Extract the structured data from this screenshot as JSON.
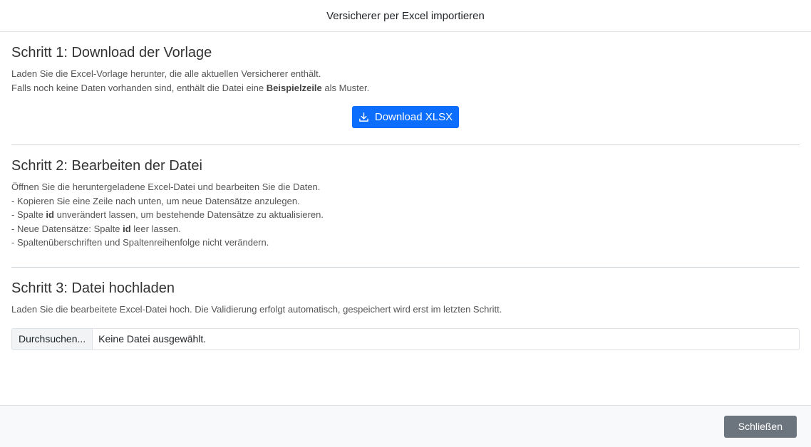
{
  "dialog": {
    "title": "Versicherer per Excel importieren"
  },
  "step1": {
    "heading": "Schritt 1: Download der Vorlage",
    "line1": "Laden Sie die Excel-Vorlage herunter, die alle aktuellen Versicherer enthält.",
    "line2_before": "Falls noch keine Daten vorhanden sind, enthält die Datei eine ",
    "line2_bold": "Beispielzeile",
    "line2_after": " als Muster.",
    "download_label": "Download XLSX",
    "download_icon": "download-icon"
  },
  "step2": {
    "heading": "Schritt 2: Bearbeiten der Datei",
    "line1": "Öffnen Sie die heruntergeladene Excel-Datei und bearbeiten Sie die Daten.",
    "line2": "- Kopieren Sie eine Zeile nach unten, um neue Datensätze anzulegen.",
    "line3_before": "- Spalte ",
    "line3_bold": "id",
    "line3_after": " unverändert lassen, um bestehende Datensätze zu aktualisieren.",
    "line4_before": "- Neue Datensätze: Spalte ",
    "line4_bold": "id",
    "line4_after": " leer lassen.",
    "line5": "- Spaltenüberschriften und Spaltenreihenfolge nicht verändern."
  },
  "step3": {
    "heading": "Schritt 3: Datei hochladen",
    "line1": "Laden Sie die bearbeitete Excel-Datei hoch. Die Validierung erfolgt automatisch, gespeichert wird erst im letzten Schritt.",
    "browse_label": "Durchsuchen...",
    "file_status": "Keine Datei ausgewählt."
  },
  "footer": {
    "close_label": "Schließen"
  },
  "colors": {
    "primary": "#0d6efd",
    "secondary": "#6c757d"
  }
}
